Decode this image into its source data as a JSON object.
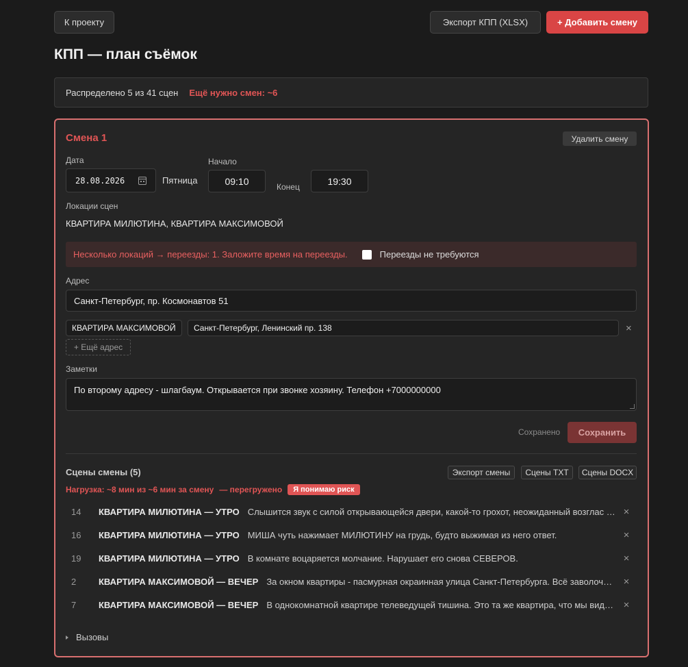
{
  "header": {
    "back_label": "К проекту",
    "export_label": "Экспорт КПП (XLSX)",
    "add_shift_label": "+ Добавить смену",
    "title": "КПП — план съёмок"
  },
  "summary": {
    "distributed": "Распределено 5 из 41 сцен",
    "needed": "Ещё нужно смен: ~6"
  },
  "shift": {
    "title": "Смена 1",
    "delete_label": "Удалить смену",
    "date_label": "Дата",
    "date_value": "28.08.2026",
    "weekday": "Пятница",
    "start_label": "Начало",
    "start_value": "09:10",
    "end_label": "Конец",
    "end_value": "19:30",
    "locations_label": "Локации сцен",
    "locations_value": "КВАРТИРА МИЛЮТИНА, КВАРТИРА МАКСИМОВОЙ",
    "warning_text": "Несколько локаций → переезды: 1. Заложите время на переезды.",
    "no_moves_label": "Переезды не требуются",
    "address_label": "Адрес",
    "address_value": "Санкт-Петербург, пр. Космонавтов 51",
    "extra_address": {
      "location": "КВАРТИРА МАКСИМОВОЙ",
      "address": "Санкт-Петербург, Ленинский пр. 138",
      "remove": "×"
    },
    "more_address_label": "+ Ещё адрес",
    "notes_label": "Заметки",
    "notes_value": "По второму адресу - шлагбаум. Открывается при звонке хозяину. Телефон +7000000000",
    "saved_label": "Сохранено",
    "save_label": "Сохранить",
    "scenes_title": "Сцены смены (5)",
    "export_shift_label": "Экспорт смены",
    "scenes_txt_label": "Сцены TXT",
    "scenes_docx_label": "Сцены DOCX",
    "load_text": "Нагрузка: ~8 мин из ~6 мин за смену",
    "overload_text": "— перегружено",
    "risk_label": "Я понимаю риск",
    "scenes": [
      {
        "num": "14",
        "loc": "КВАРТИРА МИЛЮТИНА — УТРО",
        "text": "Слышится звук с силой открывающейся двери, какой-то грохот, неожиданный возглас МИЛЮТИНА.",
        "remove": "×"
      },
      {
        "num": "16",
        "loc": "КВАРТИРА МИЛЮТИНА — УТРО",
        "text": "МИША чуть нажимает МИЛЮТИНУ на грудь, будто выжимая из него ответ.",
        "remove": "×"
      },
      {
        "num": "19",
        "loc": "КВАРТИРА МИЛЮТИНА — УТРО",
        "text": "В комнате воцаряется молчание. Нарушает его снова СЕВЕРОВ.",
        "remove": "×"
      },
      {
        "num": "2",
        "loc": "КВАРТИРА МАКСИМОВОЙ — ВЕЧЕР",
        "text": "За окном квартиры - пасмурная окраинная улица Санкт-Петербурга. Всё заволочено туманом.",
        "remove": "×"
      },
      {
        "num": "7",
        "loc": "КВАРТИРА МАКСИМОВОЙ — ВЕЧЕР",
        "text": "В однокомнатной квартире телеведущей тишина. Это та же квартира, что мы видели раньше.",
        "remove": "×"
      }
    ],
    "calls_label": "Вызовы"
  },
  "colors": {
    "accent_red": "#d94545",
    "warning_text": "#e86060",
    "card_border": "#d97070"
  }
}
